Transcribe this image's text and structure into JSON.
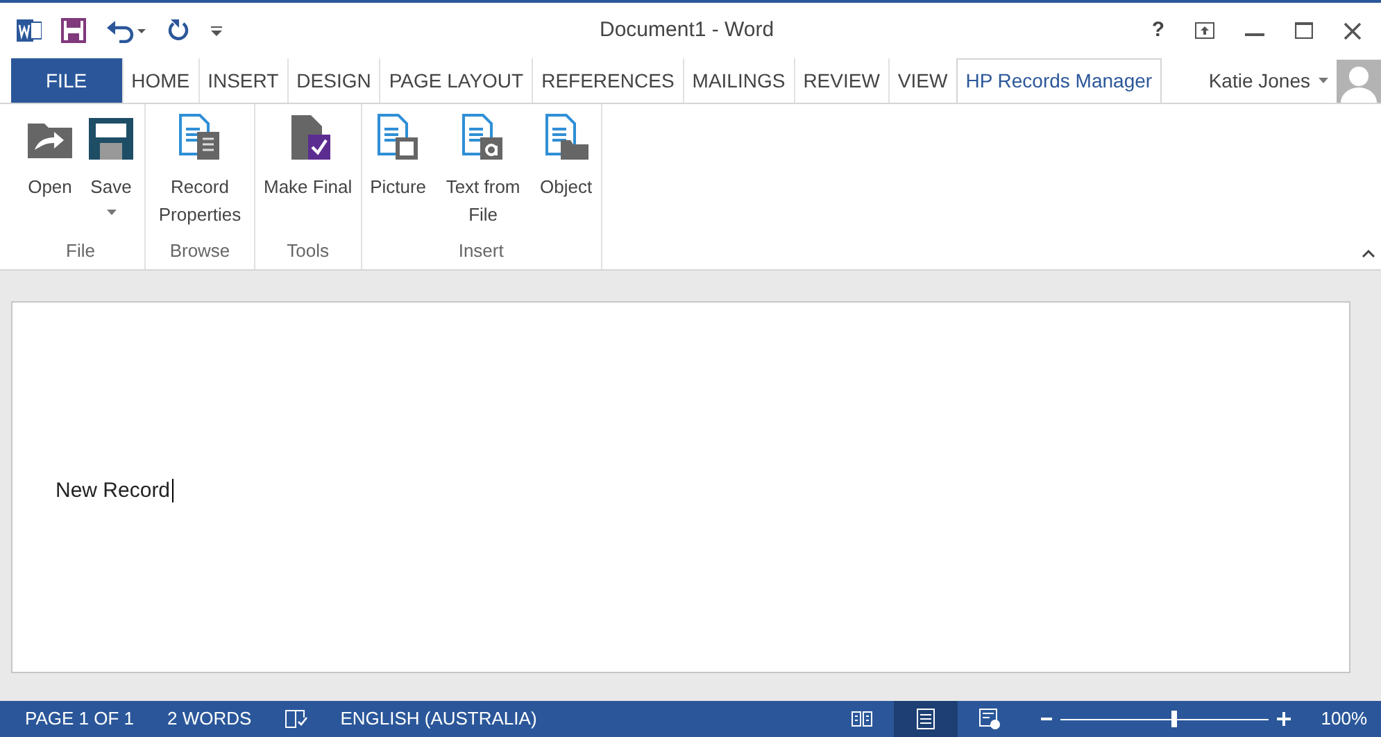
{
  "window": {
    "title": "Document1 - Word",
    "help": "?"
  },
  "tabs": [
    {
      "label": "FILE",
      "kind": "file",
      "selected": false
    },
    {
      "label": "HOME",
      "kind": "tab",
      "selected": false
    },
    {
      "label": "INSERT",
      "kind": "tab",
      "selected": false
    },
    {
      "label": "DESIGN",
      "kind": "tab",
      "selected": false
    },
    {
      "label": "PAGE LAYOUT",
      "kind": "tab",
      "selected": false
    },
    {
      "label": "REFERENCES",
      "kind": "tab",
      "selected": false
    },
    {
      "label": "MAILINGS",
      "kind": "tab",
      "selected": false
    },
    {
      "label": "REVIEW",
      "kind": "tab",
      "selected": false
    },
    {
      "label": "VIEW",
      "kind": "tab",
      "selected": false
    },
    {
      "label": "HP Records Manager",
      "kind": "tab",
      "selected": true
    }
  ],
  "account": {
    "name": "Katie Jones"
  },
  "ribbon_groups": [
    {
      "label": "File",
      "buttons": [
        {
          "label": "Open",
          "kind": "open",
          "dropdown": false
        },
        {
          "label": "Save",
          "kind": "save",
          "dropdown": true
        }
      ]
    },
    {
      "label": "Browse",
      "buttons": [
        {
          "label": "Record Properties",
          "kind": "record",
          "dropdown": false
        }
      ]
    },
    {
      "label": "Tools",
      "buttons": [
        {
          "label": "Make Final",
          "kind": "final",
          "dropdown": false
        }
      ]
    },
    {
      "label": "Insert",
      "buttons": [
        {
          "label": "Picture",
          "kind": "picture",
          "dropdown": false
        },
        {
          "label": "Text from File",
          "kind": "text",
          "dropdown": false
        },
        {
          "label": "Object",
          "kind": "object",
          "dropdown": false
        }
      ]
    }
  ],
  "document": {
    "text": "New Record"
  },
  "status_bar": {
    "page": "PAGE 1 OF 1",
    "words": "2 WORDS",
    "language": "ENGLISH (AUSTRALIA)",
    "views": [
      {
        "kind": "read",
        "selected": false
      },
      {
        "kind": "print",
        "selected": true
      },
      {
        "kind": "web",
        "selected": false
      }
    ],
    "zoom": {
      "level": 0.55,
      "reading": "100%"
    }
  }
}
